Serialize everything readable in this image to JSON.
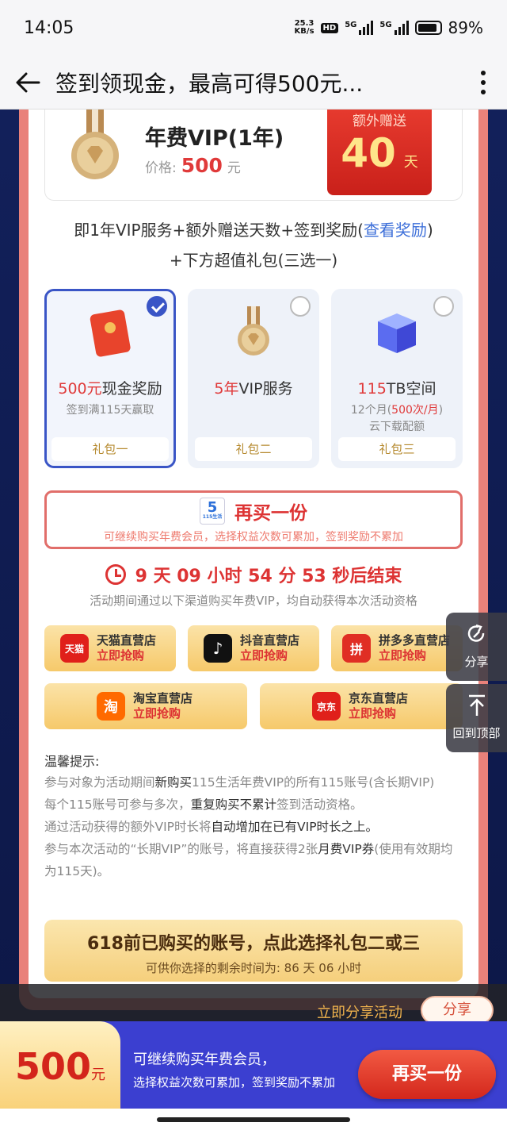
{
  "status": {
    "time": "14:05",
    "net_speed_value": "25.3",
    "net_speed_unit": "KB/s",
    "hd": "HD",
    "sim1": "5G",
    "sim2": "5G",
    "battery": "89%"
  },
  "nav": {
    "title": "签到领现金，最高可得500元..."
  },
  "vip": {
    "title": "年费VIP(1年)",
    "price_label": "价格:",
    "price": "500",
    "price_unit": "元",
    "bonus_label": "额外赠送",
    "bonus_days": "40",
    "bonus_unit": "天"
  },
  "desc": {
    "line1_prefix": "即1年VIP服务+额外赠送天数+签到奖励(",
    "line1_link": "查看奖励",
    "line1_suffix": ")",
    "line2": "+下方超值礼包(三选一)"
  },
  "packages": [
    {
      "highlight": "500元",
      "title": "现金奖励",
      "sub1": "签到满115天赢取",
      "sub2_hl": "",
      "sub2": "",
      "sub3": "",
      "footer": "礼包一",
      "selected": true
    },
    {
      "highlight": "5年",
      "title": "VIP服务",
      "sub1": "",
      "sub2_hl": "",
      "sub2": "",
      "sub3": "",
      "footer": "礼包二",
      "selected": false
    },
    {
      "highlight": "115",
      "title": "TB空间",
      "sub1": "12个月(",
      "sub2_hl": "500次/月",
      "sub2": ")",
      "sub3": "云下载配额",
      "footer": "礼包三",
      "selected": false
    }
  ],
  "buy_again": {
    "title": "再买一份",
    "sub": "可继续购买年费会员，选择权益次数可累加，签到奖励不累加",
    "logo_num": "5",
    "logo_text": "115生活"
  },
  "countdown": {
    "text": "9 天 09 小时 54 分 53 秒后结束"
  },
  "channel_note": "活动期间通过以下渠道购买年费VIP，均自动获得本次活动资格",
  "stores": [
    {
      "name": "天猫直营店",
      "cta": "立即抢购",
      "logo": "天猫",
      "color": "#e0201a"
    },
    {
      "name": "抖音直营店",
      "cta": "立即抢购",
      "logo": "♪",
      "color": "#111111"
    },
    {
      "name": "拼多多直营店",
      "cta": "立即抢购",
      "logo": "拼",
      "color": "#e02e24"
    },
    {
      "name": "淘宝直营店",
      "cta": "立即抢购",
      "logo": "淘",
      "color": "#ff6a00"
    },
    {
      "name": "京东直营店",
      "cta": "立即抢购",
      "logo": "京东",
      "color": "#e0201a"
    }
  ],
  "tips": {
    "title": "温馨提示:",
    "p1_a": "参与对象为活动期间",
    "p1_b": "新购买",
    "p1_c": "115生活年费VIP的所有115账号(含长期VIP)",
    "p2_a": "每个115账号可参与多次，",
    "p2_b": "重复购买不累计",
    "p2_c": "签到活动资格。",
    "p3_a": "通过活动获得的额外VIP时长将",
    "p3_b": "自动增加在已有VIP时长之上。",
    "p4_a": "参与本次活动的“长期VIP”的账号，将直接获得2张",
    "p4_b": "月费VIP券",
    "p4_c": "(使用有效期均为115天)。"
  },
  "box618": {
    "title": "618前已购买的账号，点此选择礼包二或三",
    "sub": "可供你选择的剩余时间为:  86 天 06 小时"
  },
  "side": {
    "share": "分享",
    "top": "回到顶部"
  },
  "share_bar": {
    "text": "立即分享活动",
    "button": "分享"
  },
  "bottom": {
    "price": "500",
    "unit": "元",
    "line1": "可继续购买年费会员，",
    "line2": "选择权益次数可累加，签到奖励不累加",
    "cta": "再买一份"
  }
}
